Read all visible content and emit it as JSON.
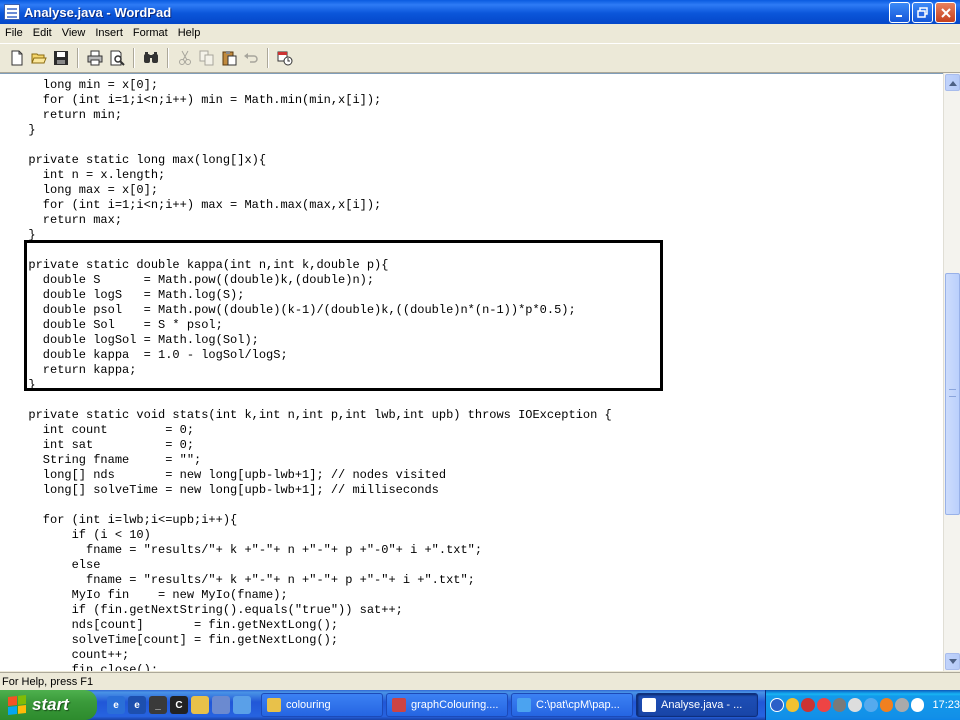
{
  "window": {
    "title": "Analyse.java - WordPad",
    "buttons": [
      "minimize",
      "maximize",
      "close"
    ]
  },
  "menu": [
    "File",
    "Edit",
    "View",
    "Insert",
    "Format",
    "Help"
  ],
  "toolbar": {
    "icons": [
      "new-icon",
      "open-icon",
      "save-icon",
      "print-icon",
      "print-preview-icon",
      "find-icon",
      "cut-icon",
      "copy-icon",
      "paste-icon",
      "undo-icon",
      "insert-datetime-icon"
    ]
  },
  "code_lines": [
    "    long min = x[0];",
    "    for (int i=1;i<n;i++) min = Math.min(min,x[i]);",
    "    return min;",
    "  }",
    "",
    "  private static long max(long[]x){",
    "    int n = x.length;",
    "    long max = x[0];",
    "    for (int i=1;i<n;i++) max = Math.max(max,x[i]);",
    "    return max;",
    "  }",
    "",
    "  private static double kappa(int n,int k,double p){",
    "    double S      = Math.pow((double)k,(double)n);",
    "    double logS   = Math.log(S);",
    "    double psol   = Math.pow((double)(k-1)/(double)k,((double)n*(n-1))*p*0.5);",
    "    double Sol    = S * psol;",
    "    double logSol = Math.log(Sol);",
    "    double kappa  = 1.0 - logSol/logS;",
    "    return kappa;",
    "  }",
    "",
    "  private static void stats(int k,int n,int p,int lwb,int upb) throws IOException {",
    "    int count        = 0;",
    "    int sat          = 0;",
    "    String fname     = \"\";",
    "    long[] nds       = new long[upb-lwb+1]; // nodes visited",
    "    long[] solveTime = new long[upb-lwb+1]; // milliseconds",
    "",
    "    for (int i=lwb;i<=upb;i++){",
    "        if (i < 10)",
    "          fname = \"results/\"+ k +\"-\"+ n +\"-\"+ p +\"-0\"+ i +\".txt\";",
    "        else",
    "          fname = \"results/\"+ k +\"-\"+ n +\"-\"+ p +\"-\"+ i +\".txt\";",
    "        MyIo fin    = new MyIo(fname);",
    "        if (fin.getNextString().equals(\"true\")) sat++;",
    "        nds[count]       = fin.getNextLong();",
    "        solveTime[count] = fin.getNextLong();",
    "        count++;",
    "        fin.close();"
  ],
  "status": {
    "help_text": "For Help, press F1"
  },
  "taskbar": {
    "start_label": "start",
    "tasks": [
      {
        "label": "colouring",
        "active": false
      },
      {
        "label": "graphColouring....",
        "active": false
      },
      {
        "label": "C:\\pat\\cpM\\pap...",
        "active": false
      },
      {
        "label": "Analyse.java - ...",
        "active": true
      }
    ],
    "clock": "17:23"
  },
  "colors": {
    "titlebar": "#0A5BE0",
    "taskbar": "#245EDC",
    "start": "#3A9A3A",
    "tray": "#1290E8"
  }
}
